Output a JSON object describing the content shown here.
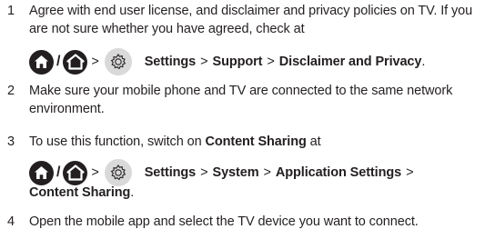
{
  "steps": [
    {
      "number": "1",
      "text": "Agree with end user license, and disclaimer and privacy policies on TV. If you are not sure whether you have agreed, check at",
      "path": {
        "home_icon": "home-icon",
        "gear_icon": "gear-icon",
        "slash": "/",
        "arrow": ">",
        "items": [
          "Settings",
          "Support",
          "Disclaimer and Privacy"
        ],
        "separator": ">",
        "end": "."
      }
    },
    {
      "number": "2",
      "text": "Make sure your mobile phone and TV are connected to the same network environment."
    },
    {
      "number": "3",
      "text_before": "To use this function, switch on ",
      "text_bold": "Content Sharing",
      "text_after": " at",
      "path": {
        "home_icon": "home-icon",
        "gear_icon": "gear-icon",
        "slash": "/",
        "arrow": ">",
        "items": [
          "Settings",
          "System",
          "Application Settings"
        ],
        "separator": ">",
        "trailing_sep": ">",
        "continuation": "Content Sharing",
        "end": "."
      }
    },
    {
      "number": "4",
      "text": "Open the mobile app and select the TV device you want to connect."
    }
  ],
  "colors": {
    "text": "#231f20",
    "icon_dark": "#231f20",
    "icon_gear_bg": "#d9d9d9"
  }
}
